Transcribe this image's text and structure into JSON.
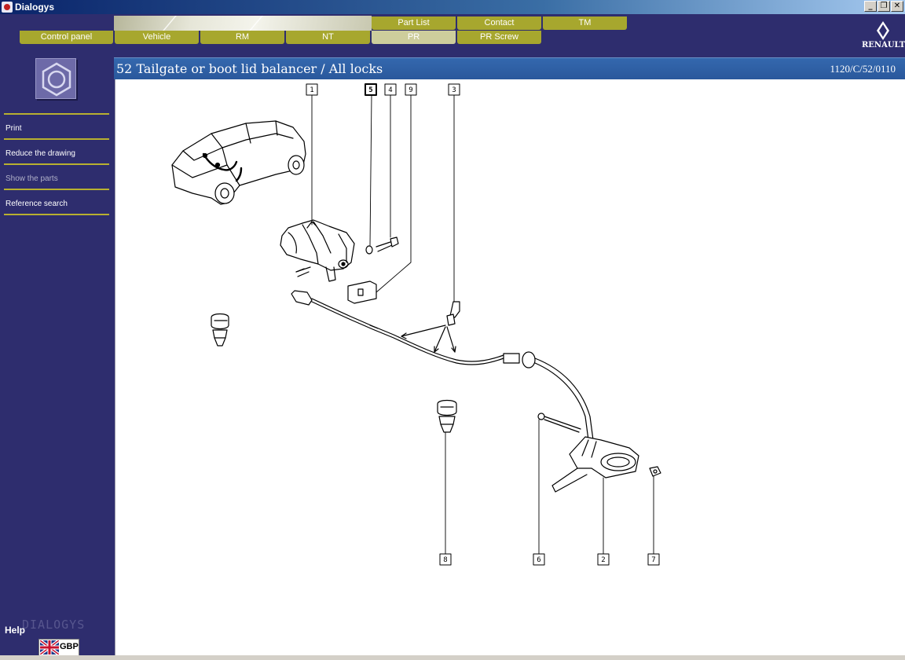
{
  "window": {
    "title": "Dialogys"
  },
  "tabs_row1": [
    {
      "label": "Part List"
    },
    {
      "label": "Contact"
    },
    {
      "label": "TM"
    }
  ],
  "tabs_row2": [
    {
      "label": "Control panel"
    },
    {
      "label": "Vehicle"
    },
    {
      "label": "RM"
    },
    {
      "label": "NT"
    },
    {
      "label": "PR",
      "active": true
    },
    {
      "label": "PR Screw"
    }
  ],
  "brand": {
    "name": "RENAULT"
  },
  "sidebar": {
    "items": [
      {
        "label": "Print",
        "enabled": true
      },
      {
        "label": "Reduce the drawing",
        "enabled": true
      },
      {
        "label": "Show the parts",
        "enabled": false
      },
      {
        "label": "Reference search",
        "enabled": true
      }
    ],
    "help": "Help",
    "watermark": "DIALOGYS",
    "language_code": "GBP"
  },
  "page": {
    "title": "52 Tailgate or boot lid balancer / All locks",
    "reference": "1120/C/52/0110"
  },
  "drawing": {
    "callouts": [
      "1",
      "5",
      "4",
      "9",
      "3",
      "8",
      "6",
      "2",
      "7"
    ]
  },
  "colors": {
    "background": "#2e2d6e",
    "tab": "#a7a72e",
    "tab_active": "#cdcd9c",
    "header_bar": "#2c5aa0",
    "accent_line": "#b8b030"
  }
}
